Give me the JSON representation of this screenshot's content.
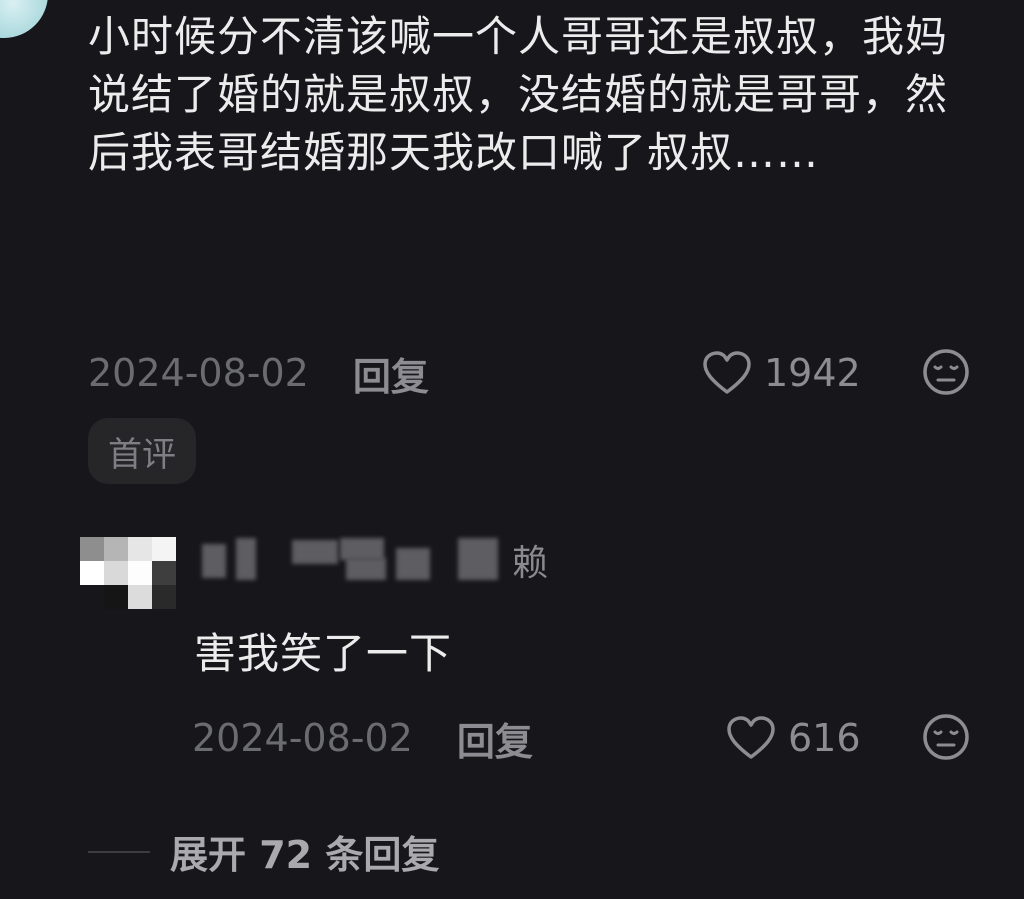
{
  "comment": {
    "text": "小时候分不清该喊一个人哥哥还是叔叔，我妈说结了婚的就是叔叔，没结婚的就是哥哥，然后我表哥结婚那天我改口喊了叔叔……",
    "date": "2024-08-02",
    "reply_label": "回复",
    "likes": "1942",
    "badge": "首评"
  },
  "reply": {
    "username_visible": "赖",
    "text": "害我笑了一下",
    "date": "2024-08-02",
    "reply_label": "回复",
    "likes": "616"
  },
  "expand_label": "展开 72 条回复",
  "icons": {
    "like": "heart-outline-icon",
    "reaction": "meh-face-icon"
  },
  "colors": {
    "background": "#16161b",
    "text_primary": "#ececec",
    "text_secondary": "#6b6b72"
  }
}
